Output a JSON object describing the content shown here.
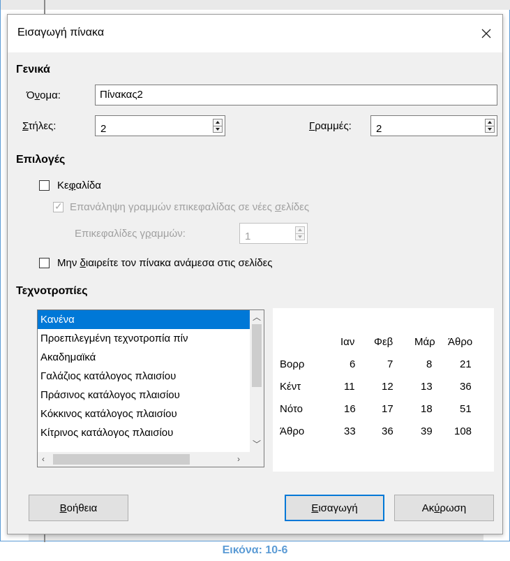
{
  "dialog": {
    "title": "Εισαγωγή πίνακα",
    "close_icon": "close-icon"
  },
  "general": {
    "heading": "Γενικά",
    "name_label": "Όνομα:",
    "name_value": "Πίνακας2",
    "columns_label": "Στήλες:",
    "columns_value": "2",
    "rows_label": "Γραμμές:",
    "rows_value": "2"
  },
  "options": {
    "heading": "Επιλογές",
    "heading_checkbox_label": "Κεφαλίδα",
    "heading_checked": false,
    "repeat_heading_label": "Επανάληψη γραμμών επικεφαλίδας σε νέες σελίδες",
    "repeat_heading_checked": true,
    "heading_rows_label": "Επικεφαλίδες γραμμών:",
    "heading_rows_value": "1",
    "dont_split_label": "Μην διαιρείτε τον πίνακα ανάμεσα στις σελίδες",
    "dont_split_checked": false
  },
  "styles": {
    "heading": "Τεχνοτροπίες",
    "selected_index": 0,
    "items": [
      "Κανένα",
      "Προεπιλεγμένη τεχνοτροπία πίν",
      "Ακαδημαϊκά",
      "Γαλάζιος κατάλογος πλαισίου",
      "Πράσινος κατάλογος πλαισίου",
      "Κόκκινος κατάλογος πλαισίου",
      "Κίτρινος κατάλογος πλαισίου"
    ]
  },
  "preview": {
    "col_headers": [
      "Ιαν",
      "Φεβ",
      "Μάρ",
      "Άθρο"
    ],
    "rows": [
      {
        "label": "Βορρ",
        "values": [
          "6",
          "7",
          "8",
          "21"
        ]
      },
      {
        "label": "Κέντ",
        "values": [
          "11",
          "12",
          "13",
          "36"
        ]
      },
      {
        "label": "Νότο",
        "values": [
          "16",
          "17",
          "18",
          "51"
        ]
      },
      {
        "label": "Άθρο",
        "values": [
          "33",
          "36",
          "39",
          "108"
        ]
      }
    ]
  },
  "buttons": {
    "help": "Βοήθεια",
    "insert": "Εισαγωγή",
    "cancel": "Ακύρωση"
  },
  "caption": "Εικόνα: 10-6",
  "colors": {
    "accent": "#0078d7",
    "caption": "#5b9bd5",
    "dialog_bg": "#f0f0f0"
  }
}
